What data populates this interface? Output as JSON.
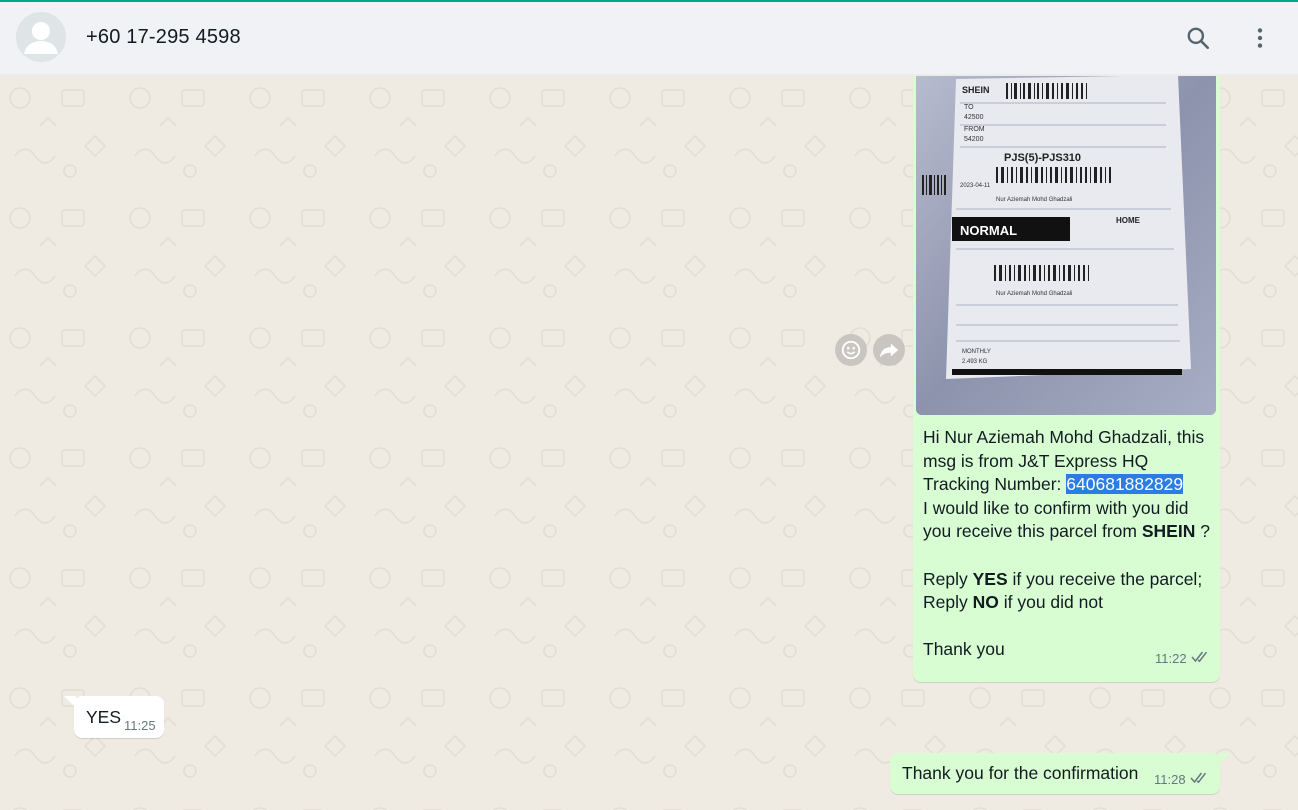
{
  "header": {
    "contact_name": "+60 17-295 4598",
    "icons": [
      "default-avatar-icon",
      "search-icon",
      "menu-icon"
    ]
  },
  "colors": {
    "accent": "#00a884",
    "outgoing_bubble": "#d9fdd3",
    "incoming_bubble": "#ffffff",
    "chat_background": "#efeae2",
    "header_background": "#f0f2f5",
    "selection_highlight": "#2a7de1",
    "read_tick": "#667781"
  },
  "messages": [
    {
      "direction": "outgoing",
      "type": "image",
      "image": {
        "label_brand": "SHEIN",
        "to_code_1": "TO",
        "postcode_1": "42500",
        "from_code_1": "FROM",
        "postcode_2": "54200",
        "route_code": "PJS(5)-PJS310",
        "date": "2023-04-11",
        "service": "NORMAL",
        "delivery_type": "HOME",
        "recipient": "Nur Aziemah Mohd Ghadzali",
        "weight": "2.493 KG",
        "monthly": "MONTHLY"
      },
      "text_lines": {
        "l1": "Hi Nur Aziemah Mohd Ghadzali, this",
        "l2": "msg is from J&T Express HQ",
        "l3_prefix": "Tracking Number: ",
        "l3_tracking": "640681882829",
        "l4": "I would like to confirm with you did",
        "l5_prefix": "you receive this parcel from ",
        "l5_bold": "SHEIN",
        "l5_suffix": " ?",
        "l6_prefix": "Reply ",
        "l6_bold": "YES",
        "l6_suffix": " if you receive the parcel;",
        "l7_prefix": "Reply ",
        "l7_bold": "NO",
        "l7_suffix": " if you did not",
        "l8": "Thank you"
      },
      "time": "11:22",
      "status_icon": "double-check-icon"
    },
    {
      "direction": "incoming",
      "type": "text",
      "text": "YES",
      "time": "11:25"
    },
    {
      "direction": "outgoing",
      "type": "text",
      "text": "Thank you for the confirmation",
      "time": "11:28",
      "status_icon": "double-check-icon"
    }
  ],
  "hover_actions": [
    "emoji-react-icon",
    "forward-icon"
  ]
}
